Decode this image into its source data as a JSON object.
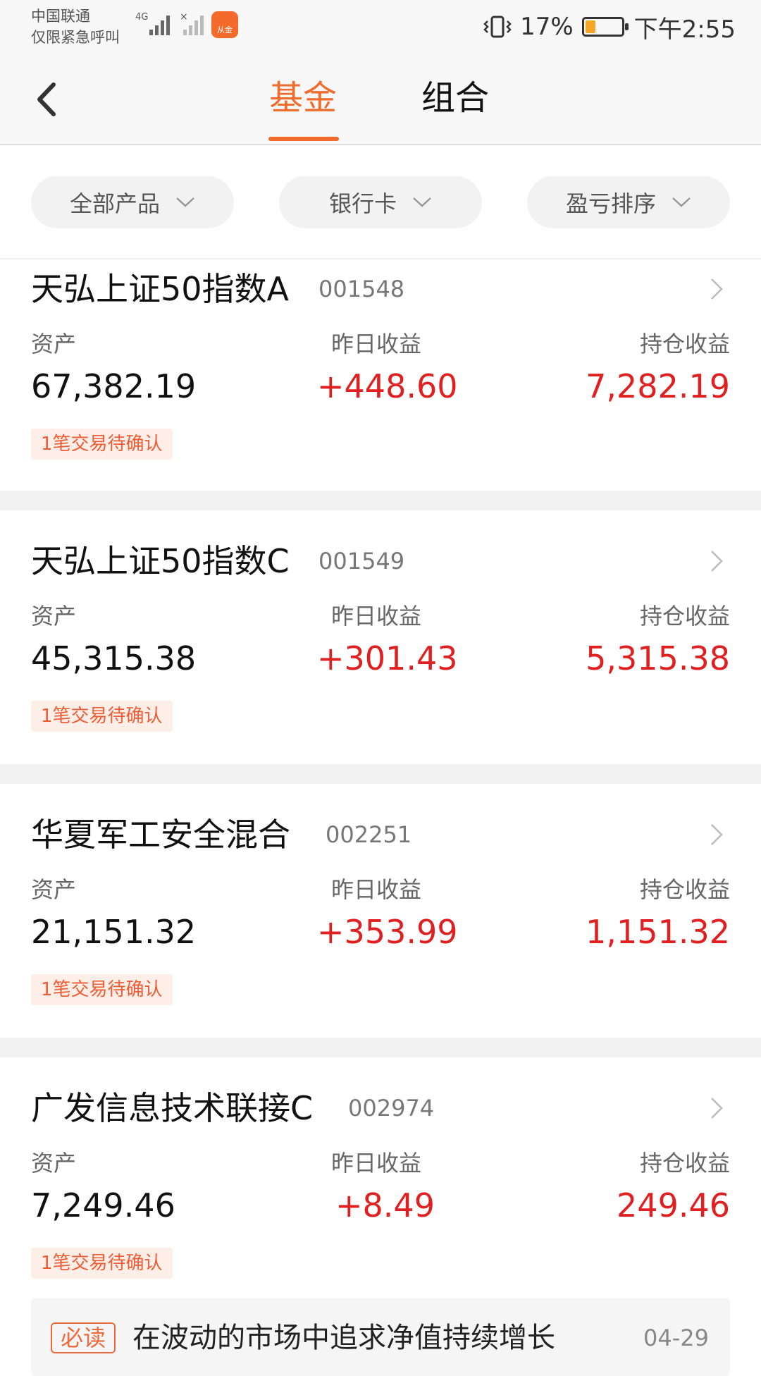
{
  "status_bar": {
    "carrier": "中国联通",
    "carrier_note": "仅限紧急呼叫",
    "network": "4G",
    "app_badge": "从金",
    "battery": "17%",
    "time": "下午2:55"
  },
  "nav": {
    "tabs": [
      "基金",
      "组合"
    ],
    "active_tab": "基金",
    "accent_color": "#f06b2c"
  },
  "filters": [
    {
      "label": "全部产品"
    },
    {
      "label": "银行卡"
    },
    {
      "label": "盈亏排序"
    }
  ],
  "column_labels": {
    "assets": "资产",
    "yesterday": "昨日收益",
    "holding": "持仓收益"
  },
  "funds": [
    {
      "name": "天弘上证50指数A",
      "code": "001548",
      "assets": "67,382.19",
      "yesterday": "+448.60",
      "holding": "7,282.19",
      "pending": "1笔交易待确认"
    },
    {
      "name": "天弘上证50指数C",
      "code": "001549",
      "assets": "45,315.38",
      "yesterday": "+301.43",
      "holding": "5,315.38",
      "pending": "1笔交易待确认"
    },
    {
      "name": "华夏军工安全混合",
      "code": "002251",
      "assets": "21,151.32",
      "yesterday": "+353.99",
      "holding": "1,151.32",
      "pending": "1笔交易待确认"
    },
    {
      "name": "广发信息技术联接C",
      "code": "002974",
      "assets": "7,249.46",
      "yesterday": "+8.49",
      "holding": "249.46",
      "pending": "1笔交易待确认"
    }
  ],
  "news": {
    "tag": "必读",
    "title": "在波动的市场中追求净值持续增长",
    "date": "04-29"
  },
  "colors": {
    "gain": "#e02020",
    "pending_bg": "#fdeee8",
    "pending_text": "#ee5c35"
  }
}
